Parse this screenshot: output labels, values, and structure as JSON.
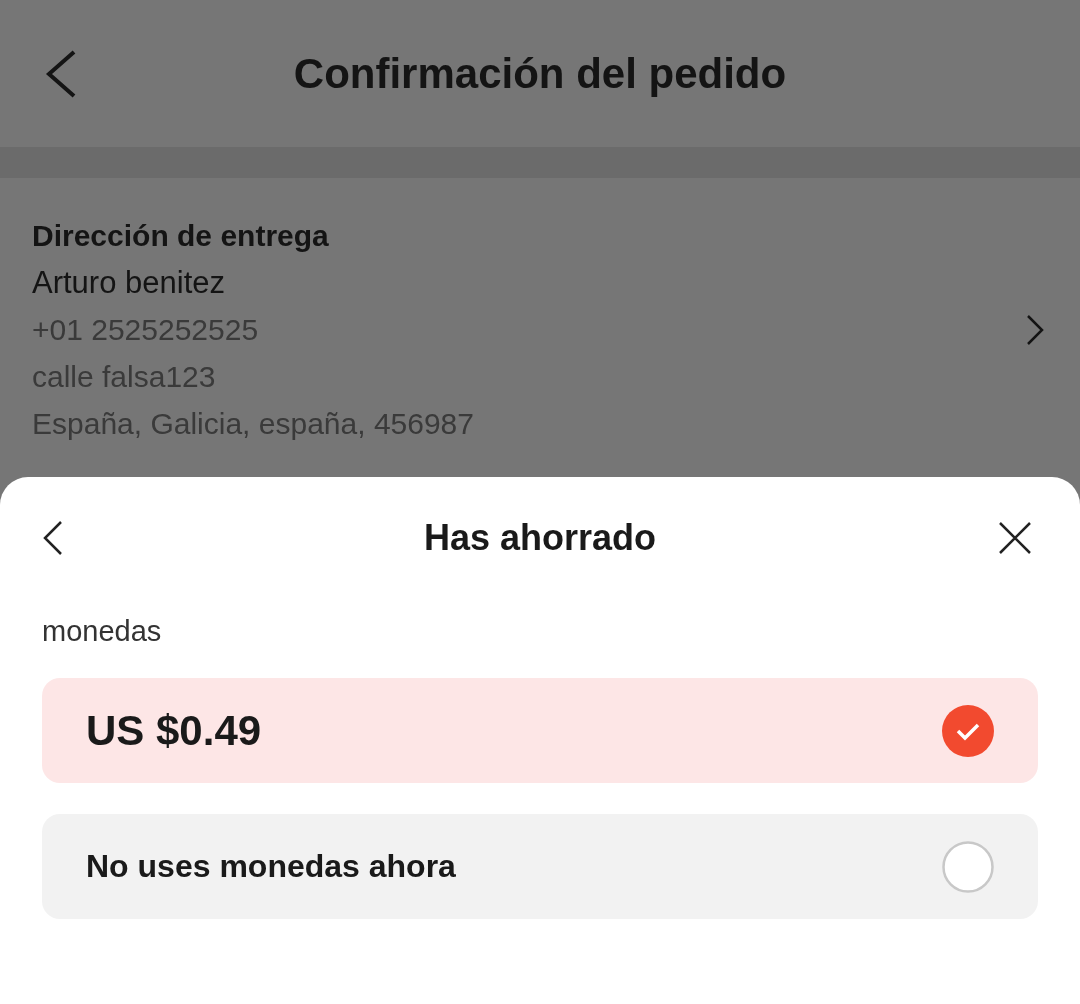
{
  "header": {
    "title": "Confirmación del pedido"
  },
  "address": {
    "heading": "Dirección de entrega",
    "name": "Arturo benitez",
    "lines": [
      "+01 2525252525",
      "calle falsa123",
      "España, Galicia, españa, 456987"
    ]
  },
  "sheet": {
    "title": "Has ahorrado",
    "section_label": "monedas",
    "options": [
      {
        "label": "US $0.49",
        "kind": "amount",
        "selected": true
      },
      {
        "label": "No uses monedas ahora",
        "kind": "plain",
        "selected": false
      }
    ]
  }
}
